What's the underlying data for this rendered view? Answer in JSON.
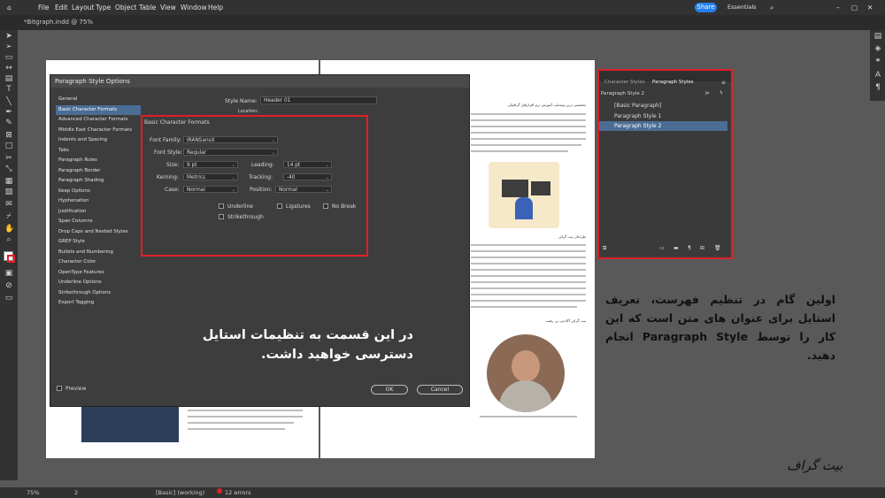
{
  "menubar": {
    "items": [
      "File",
      "Edit",
      "Layout",
      "Type",
      "Object",
      "Table",
      "View",
      "Window",
      "Help"
    ],
    "share_label": "Share",
    "workspace": "Essentials"
  },
  "document_tab": {
    "label": "*Bitgraph.indd @ 75%"
  },
  "statusbar": {
    "zoom": "75%",
    "page": "2",
    "style": "[Basic] (working)",
    "errors": "12 errors"
  },
  "dialog": {
    "title": "Paragraph Style Options",
    "style_name_label": "Style Name:",
    "style_name_value": "Header 01",
    "location_label": "Location:",
    "categories": [
      "General",
      "Basic Character Formats",
      "Advanced Character Formats",
      "Middle East Character Formats",
      "Indents and Spacing",
      "Tabs",
      "Paragraph Rules",
      "Paragraph Border",
      "Paragraph Shading",
      "Keep Options",
      "Hyphenation",
      "Justification",
      "Span Columns",
      "Drop Caps and Nested Styles",
      "GREP Style",
      "Bullets and Numbering",
      "Character Color",
      "OpenType Features",
      "Underline Options",
      "Strikethrough Options",
      "Export Tagging"
    ],
    "selected_category": "Basic Character Formats",
    "section_title": "Basic Character Formats",
    "font_family_label": "Font Family:",
    "font_family_value": "IRANSansX",
    "font_style_label": "Font Style:",
    "font_style_value": "Regular",
    "size_label": "Size:",
    "size_value": "9 pt",
    "leading_label": "Leading:",
    "leading_value": "14 pt",
    "kerning_label": "Kerning:",
    "kerning_value": "Metrics",
    "tracking_label": "Tracking:",
    "tracking_value": "-40",
    "case_label": "Case:",
    "case_value": "Normal",
    "position_label": "Position:",
    "position_value": "Normal",
    "underline_label": "Underline",
    "ligatures_label": "Ligatures",
    "nobreak_label": "No Break",
    "strikethrough_label": "Strikethrough",
    "preview_label": "Preview",
    "ok_label": "OK",
    "cancel_label": "Cancel"
  },
  "callouts": {
    "dialog_note": "در این قسمت به تنظیمات استایل دسترسی خواهید داشت.",
    "panel_note": "اولین گام در تنظیم فهرست، تعریف استایل برای عنوان های متن است که این کار را توسط Paragraph Style انجام دهید."
  },
  "styles_panel": {
    "tab_character": "Character Styles",
    "tab_paragraph": "Paragraph Styles",
    "current_style": "Paragraph Style 2",
    "items": [
      "[Basic Paragraph]",
      "Paragraph Style 1",
      "Paragraph Style 2"
    ],
    "selected": "Paragraph Style 2"
  },
  "page_right": {
    "heading_1": "تخصصی ترین وبسایت آموزش نرم افزارهای گرافیکی",
    "heading_2": "طراحان بیت گراف",
    "heading_3": "بیت گراف آکادمی بی رقیب"
  },
  "brand": {
    "logo_text": "بیت گراف"
  },
  "colors": {
    "accent": "#2680eb",
    "highlight": "#e01f26",
    "selection": "#4b6d94"
  }
}
